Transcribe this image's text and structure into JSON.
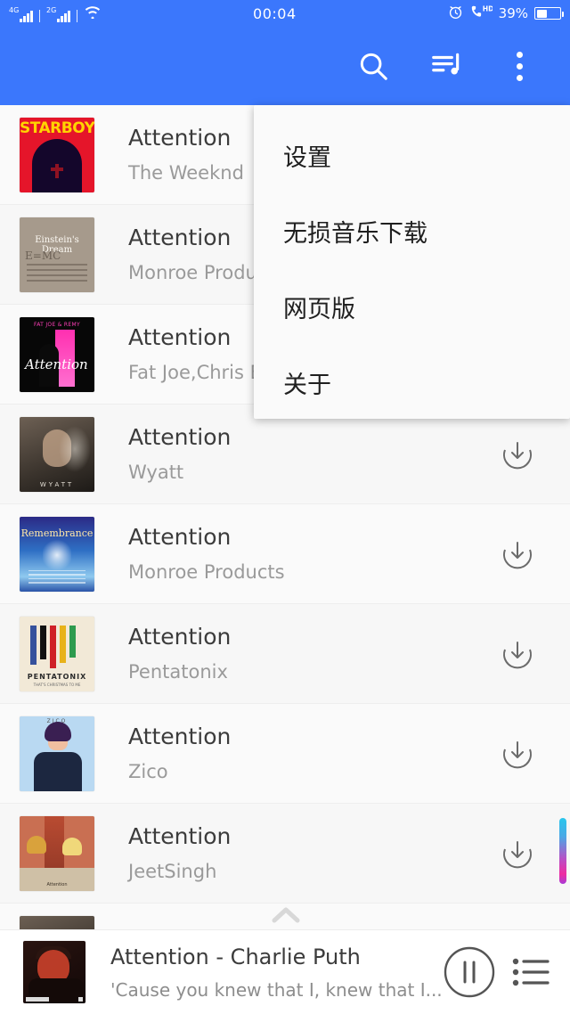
{
  "status_bar": {
    "signal_1_label": "4G",
    "signal_2_label": "2G",
    "wifi_icon": "wifi-icon",
    "time": "00:04",
    "alarm_icon": "alarm-clock-icon",
    "hd_call_icon": "hd-volte-icon",
    "battery_percent": "39%"
  },
  "app_bar": {
    "search_icon": "search-icon",
    "playlist_icon": "music-queue-icon",
    "overflow_icon": "more-vertical-icon"
  },
  "overflow_menu": {
    "items": [
      {
        "label": "设置"
      },
      {
        "label": "无损音乐下载"
      },
      {
        "label": "网页版"
      },
      {
        "label": "关于"
      }
    ]
  },
  "song_list": {
    "download_icon": "download-circle-icon",
    "rows": [
      {
        "title": "Attention",
        "artist": "The Weeknd",
        "art": "a-starboy"
      },
      {
        "title": "Attention",
        "artist": "Monroe Products",
        "art": "a-einstein"
      },
      {
        "title": "Attention",
        "artist": "Fat Joe,Chris Bro",
        "art": "a-fatjoe"
      },
      {
        "title": "Attention",
        "artist": "Wyatt",
        "art": "a-wyatt"
      },
      {
        "title": "Attention",
        "artist": "Monroe Products",
        "art": "a-remem"
      },
      {
        "title": "Attention",
        "artist": "Pentatonix",
        "art": "a-penta"
      },
      {
        "title": "Attention",
        "artist": "Zico",
        "art": "a-zico"
      },
      {
        "title": "Attention",
        "artist": "JeetSingh",
        "art": "a-anime"
      }
    ]
  },
  "scroll_to_top": {
    "icon": "chevron-up-icon"
  },
  "scrollbar": {
    "gradient_start": "#29c6ec",
    "gradient_end": "#ef2aa0"
  },
  "player": {
    "title": "Attention - Charlie Puth",
    "lyric": "'Cause you knew that I, knew that I...",
    "pause_icon": "pause-circle-icon",
    "queue_icon": "playlist-icon",
    "art": "a-puth"
  },
  "colors": {
    "accent_blue": "#3b77fc",
    "list_bg": "#fafafa",
    "title_text": "#3c3c3c",
    "artist_text": "#9a9a9a"
  }
}
